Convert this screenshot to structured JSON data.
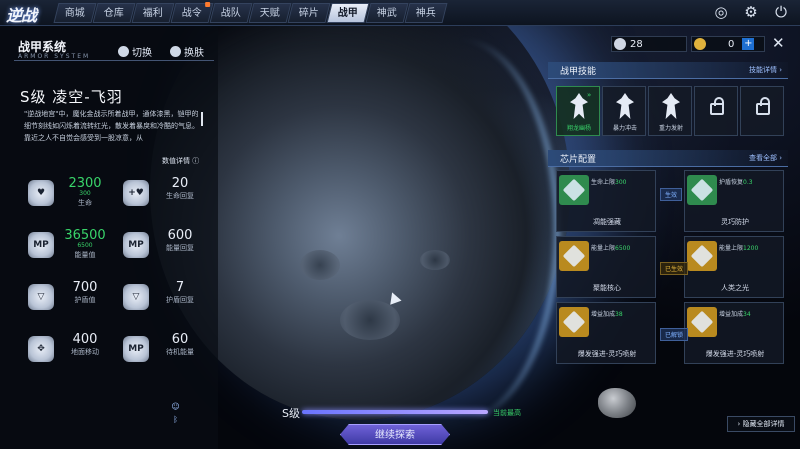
{
  "nav": {
    "logo": "逆战",
    "tabs": [
      {
        "label": "商城"
      },
      {
        "label": "仓库"
      },
      {
        "label": "福利"
      },
      {
        "label": "战令"
      },
      {
        "label": "战队"
      },
      {
        "label": "天赋"
      },
      {
        "label": "碎片"
      },
      {
        "label": "战甲",
        "active": true
      },
      {
        "label": "神武"
      },
      {
        "label": "神兵"
      }
    ],
    "icons": [
      "compass-icon",
      "gear-icon",
      "power-icon"
    ]
  },
  "resources": [
    {
      "icon": "crystal-icon",
      "value": "28"
    },
    {
      "icon": "gold-coin-icon",
      "value": "0"
    }
  ],
  "left_panel": {
    "title": "战甲系统",
    "subtitle": "ARMOR SYSTEM",
    "switch_label": "切换",
    "skin_label": "换肤",
    "armor_name": "S级 凌空-飞羽",
    "description": "\"逆战地宫\"中，魔化金战示所着战甲，通体漆黑，铠甲的细节刻线如闪烁着流转红光，散发着暴戾和冷酷的气息。靠近之人不自觉会感受到一股凉意，从",
    "detail_link": "数值详情 ⓘ",
    "stats": [
      {
        "icon": "shield-heart-icon",
        "value": "2300",
        "base": "300",
        "label": "生命",
        "highlight": true
      },
      {
        "icon": "heart-plus-icon",
        "value": "20",
        "base": "",
        "label": "生命回复",
        "highlight": false
      },
      {
        "icon": "mp-icon",
        "value": "36500",
        "base": "6500",
        "label": "能量值",
        "highlight": true
      },
      {
        "icon": "mp-regen-icon",
        "value": "600",
        "base": "",
        "label": "能量回复",
        "highlight": false
      },
      {
        "icon": "armor-icon",
        "value": "700",
        "base": "",
        "label": "护盾值",
        "highlight": false
      },
      {
        "icon": "armor-regen-icon",
        "value": "7",
        "base": "",
        "label": "护盾回复",
        "highlight": false
      },
      {
        "icon": "move-arrows-icon",
        "value": "400",
        "base": "",
        "label": "地面移动",
        "highlight": false
      },
      {
        "icon": "mp-standby-icon",
        "value": "60",
        "base": "",
        "label": "待机能量",
        "highlight": false
      }
    ]
  },
  "bottom": {
    "grade_label": "S级",
    "grade_status": "当前最高",
    "explore_button": "继续探索"
  },
  "right_panel": {
    "skills_title": "战甲技能",
    "skills_link": "技能详情 ›",
    "skills": [
      {
        "name": "翔龙幽杨",
        "active": true,
        "locked": false
      },
      {
        "name": "暴力冲击",
        "active": false,
        "locked": false
      },
      {
        "name": "重力发射",
        "active": false,
        "locked": false
      },
      {
        "name": "",
        "active": false,
        "locked": true
      },
      {
        "name": "",
        "active": false,
        "locked": true
      }
    ],
    "chips_title": "芯片配置",
    "chips_link": "查看全部 ›",
    "chips": [
      {
        "name": "凋能强藏",
        "attr": "生命上限",
        "bonus": "300",
        "color": "#2f8b4e"
      },
      {
        "name": "灵巧防护",
        "attr": "护盾恢复",
        "bonus": "0.3",
        "color": "#2f8b4e"
      },
      {
        "name": "聚能核心",
        "attr": "能量上限",
        "bonus": "6500",
        "color": "#b98a1f"
      },
      {
        "name": "人类之光",
        "attr": "能量上限",
        "bonus": "1200",
        "color": "#b98a1f"
      },
      {
        "name": "爆发强进-灵巧喷射",
        "attr": "增益加成",
        "bonus": "38",
        "color": "#b98a1f"
      },
      {
        "name": "爆发强进-灵巧喷射",
        "attr": "增益加成",
        "bonus": "34",
        "color": "#b98a1f"
      }
    ],
    "connectors": [
      "生效",
      "已生效",
      "已解锁"
    ],
    "all_detail": "› 隐藏全部详情"
  },
  "colors": {
    "accent": "#6f62d8",
    "green": "#39d46a",
    "gold": "#e0b23c",
    "blue": "#1e6fd1"
  }
}
